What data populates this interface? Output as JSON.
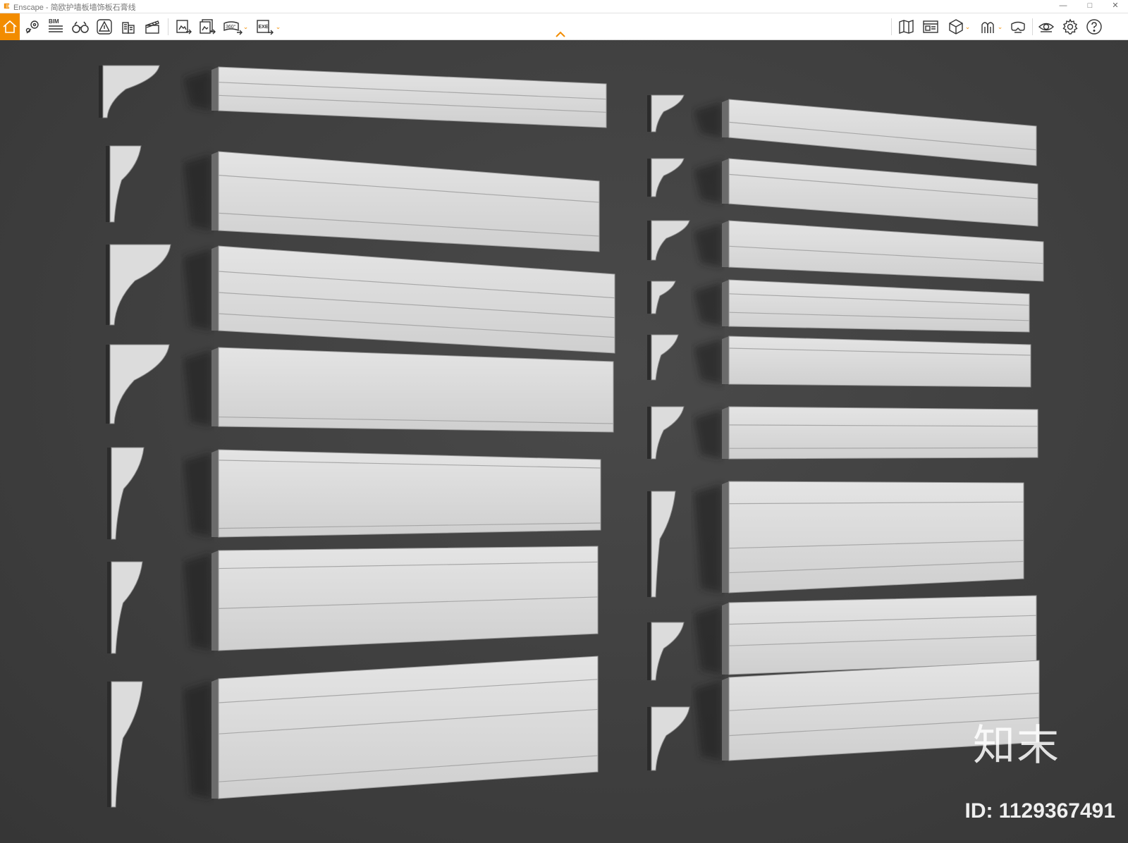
{
  "window": {
    "app_name": "Enscape",
    "separator": " - ",
    "document_title": "简欧护墙板墙饰板石膏线",
    "minimize_icon": "minimize-icon",
    "maximize_icon": "maximize-icon",
    "close_icon": "close-icon"
  },
  "toolbar": {
    "accent_color": "#f28c00",
    "left_tools": [
      {
        "name": "home-button",
        "icon": "home-icon"
      },
      {
        "name": "view-management-button",
        "icon": "map-pin-icon"
      },
      {
        "name": "bim-info-button",
        "icon": "bim-icon",
        "label": "BIM"
      },
      {
        "name": "minimap-button",
        "icon": "binoculars-icon"
      },
      {
        "name": "atmosphere-button",
        "icon": "atmosphere-icon"
      },
      {
        "name": "asset-library-button",
        "icon": "buildings-icon"
      },
      {
        "name": "video-editor-button",
        "icon": "clapperboard-icon"
      },
      {
        "name": "screenshot-button",
        "icon": "image-export-icon"
      },
      {
        "name": "batch-render-button",
        "icon": "batch-export-icon"
      },
      {
        "name": "panorama-button",
        "icon": "panorama-360-icon",
        "label": "360°",
        "dropdown": true
      },
      {
        "name": "exe-export-button",
        "icon": "exe-export-icon",
        "label": "EXE",
        "dropdown": true
      }
    ],
    "right_tools": [
      {
        "name": "map-button",
        "icon": "map-icon"
      },
      {
        "name": "capture-button",
        "icon": "capture-icon"
      },
      {
        "name": "view-cube-button",
        "icon": "cube-icon",
        "dropdown": true
      },
      {
        "name": "materials-button",
        "icon": "arch-icon",
        "dropdown": true
      },
      {
        "name": "vr-headset-button",
        "icon": "vr-headset-icon"
      },
      {
        "name": "visibility-button",
        "icon": "eye-icon"
      },
      {
        "name": "settings-button",
        "icon": "gear-icon"
      },
      {
        "name": "help-button",
        "icon": "help-icon"
      }
    ],
    "collapse_icon": "chevron-up-icon"
  },
  "viewport": {
    "background": "#3f3f3f",
    "molding_color": "#dedede",
    "watermark_brand": "知末",
    "watermark_id": "ID: 1129367491"
  }
}
